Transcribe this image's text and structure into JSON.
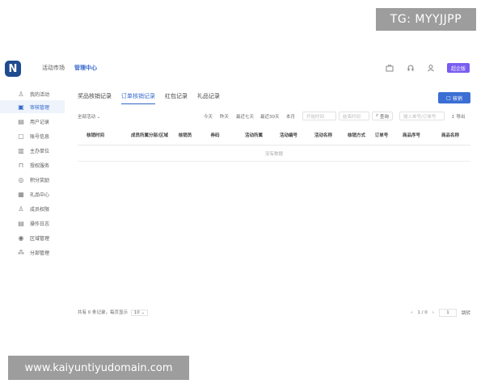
{
  "watermarks": {
    "top": "TG: MYYJJPP",
    "bottom": "www.kaiyuntiyudomain.com"
  },
  "header": {
    "logo": "N",
    "nav": [
      "活动市场",
      "管理中心"
    ],
    "active_nav": "管理中心",
    "badge": "超企版",
    "icons": [
      "briefcase-icon",
      "headset-icon",
      "user-icon"
    ]
  },
  "sidebar": {
    "items": [
      {
        "label": "我的活动",
        "icon": "user-icon"
      },
      {
        "label": "审核管理",
        "icon": "clipboard-icon"
      },
      {
        "label": "用户记录",
        "icon": "list-icon"
      },
      {
        "label": "账号信息",
        "icon": "id-card-icon"
      },
      {
        "label": "主办单位",
        "icon": "building-icon"
      },
      {
        "label": "授权服务",
        "icon": "lock-icon"
      },
      {
        "label": "积分奖励",
        "icon": "coin-icon"
      },
      {
        "label": "礼品中心",
        "icon": "gift-icon"
      },
      {
        "label": "成员权限",
        "icon": "people-icon"
      },
      {
        "label": "操作日志",
        "icon": "log-icon"
      },
      {
        "label": "区域管理",
        "icon": "pin-icon"
      },
      {
        "label": "分部管理",
        "icon": "org-icon"
      }
    ],
    "active_index": 1
  },
  "main": {
    "tabs": [
      "奖品核销记录",
      "订单核销记录",
      "红包记录",
      "礼品记录"
    ],
    "active_tab": 1,
    "add_button": "核销",
    "filters": {
      "select_all": "全部活动",
      "quick": [
        "今天",
        "昨天",
        "最近七天",
        "最近30天",
        "本月"
      ],
      "start_placeholder": "开始时间",
      "end_placeholder": "结束时间",
      "search_button": "查询",
      "input_placeholder": "输入单号/订单号",
      "export_button": "导出"
    },
    "columns": [
      "核销时间",
      "成员所属分部/区域",
      "核销员",
      "券码",
      "活动所属",
      "活动编号",
      "活动名称",
      "核销方式",
      "订单号",
      "商品序号",
      "商品名称"
    ],
    "empty_text": "没有数据",
    "footer": {
      "total_text": "共有 0 条记录，每页显示",
      "page_size": "10",
      "page_info": "1 / 0",
      "goto_value": "1",
      "jump_label": "跳转"
    }
  }
}
